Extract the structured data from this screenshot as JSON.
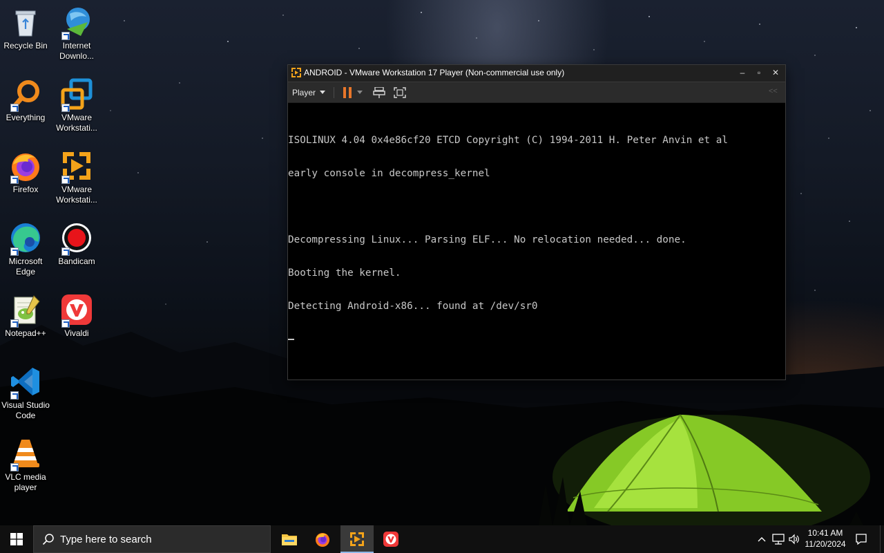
{
  "desktop": {
    "icons": [
      {
        "name": "recycle-bin-icon",
        "label": "Recycle Bin"
      },
      {
        "name": "internet-download-manager-icon",
        "label": "Internet Downlo..."
      },
      {
        "name": "everything-icon",
        "label": "Everything"
      },
      {
        "name": "vmware-workstation-icon",
        "label": "VMware Workstati..."
      },
      {
        "name": "firefox-icon",
        "label": "Firefox"
      },
      {
        "name": "vmware-workstation-player-icon",
        "label": "VMware Workstati..."
      },
      {
        "name": "microsoft-edge-icon",
        "label": "Microsoft Edge"
      },
      {
        "name": "bandicam-icon",
        "label": "Bandicam"
      },
      {
        "name": "notepad-plus-plus-icon",
        "label": "Notepad++"
      },
      {
        "name": "vivaldi-icon",
        "label": "Vivaldi"
      },
      {
        "name": "visual-studio-code-icon",
        "label": "Visual Studio Code"
      },
      {
        "name": "vlc-media-player-icon",
        "label": "VLC media player"
      }
    ]
  },
  "vm_window": {
    "title": "ANDROID - VMware Workstation 17 Player (Non-commercial use only)",
    "controls": {
      "minimize": "–",
      "maximize": "▫",
      "close": "✕"
    },
    "toolbar": {
      "player_menu_label": "Player",
      "collapse_label": "<<"
    },
    "console_lines": [
      "ISOLINUX 4.04 0x4e86cf20 ETCD Copyright (C) 1994-2011 H. Peter Anvin et al",
      "early console in decompress_kernel",
      "",
      "Decompressing Linux... Parsing ELF... No relocation needed... done.",
      "Booting the kernel.",
      "Detecting Android-x86... found at /dev/sr0"
    ]
  },
  "taskbar": {
    "search_placeholder": "Type here to search",
    "pinned": [
      {
        "name": "file-explorer-icon"
      },
      {
        "name": "firefox-icon"
      },
      {
        "name": "vmware-player-icon",
        "active": true
      },
      {
        "name": "vivaldi-icon"
      }
    ],
    "tray": {
      "time": "10:41 AM",
      "date": "11/20/2024"
    }
  },
  "colors": {
    "accent": "#8fb8e8",
    "taskbar_bg": "#101010",
    "console_text": "#c8c8c8",
    "tent_green": "#9be03a",
    "pause_orange": "#e8762a"
  }
}
